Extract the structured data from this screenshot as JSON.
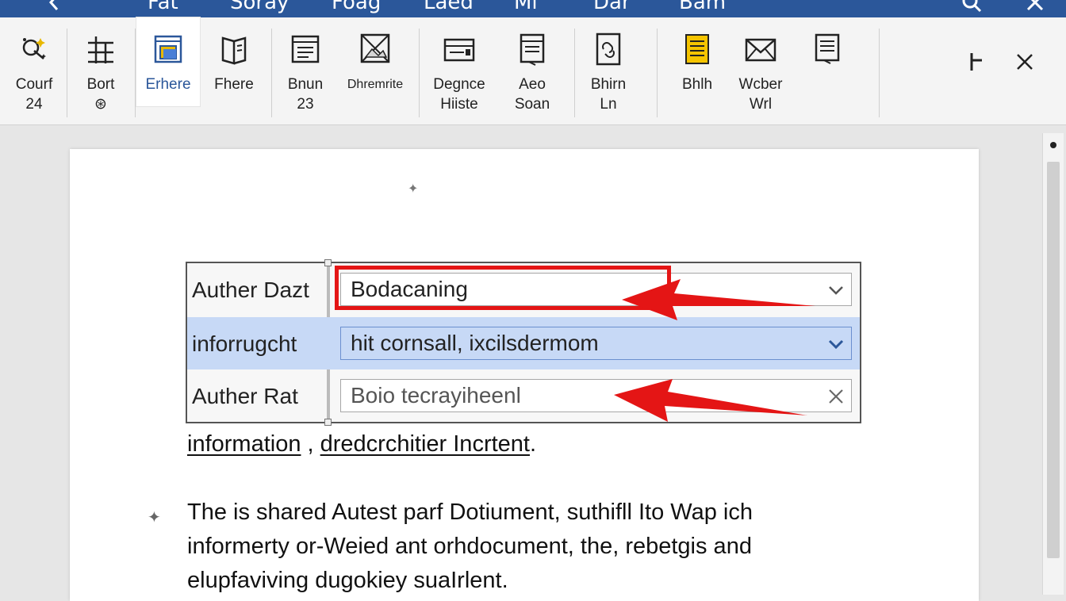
{
  "titlebar": {
    "tabs": [
      "Fat",
      "Soray",
      "Foag",
      "Laed",
      "Ml",
      "Dar",
      "Bam"
    ]
  },
  "ribbon": {
    "buttons": [
      {
        "label": "Courf\n24",
        "icon": "sparkle-icon"
      },
      {
        "label": "Bort\n⊛",
        "icon": "table-tool-icon"
      },
      {
        "label": "Erhere",
        "icon": "insert-frame-icon",
        "active": true
      },
      {
        "label": "Fhere",
        "icon": "book-icon"
      },
      {
        "label": "Bnun\n23",
        "icon": "list-box-icon"
      },
      {
        "label": "Dhremrite",
        "icon": "picture-icon"
      },
      {
        "label": "Degnce\nHiiste",
        "icon": "card-icon"
      },
      {
        "label": "Aeo\nSoan",
        "icon": "document-icon"
      },
      {
        "label": "Bhirn\nLn",
        "icon": "link-document-icon"
      },
      {
        "label": "Bhlh",
        "icon": "yellow-note-icon"
      },
      {
        "label": "Wcber\nWrl",
        "icon": "envelope-icon"
      },
      {
        "label": "",
        "icon": "page-lines-icon"
      }
    ]
  },
  "form": {
    "rows": [
      {
        "label": "Auther Dazt",
        "value": "Bodacaning",
        "control": "dropdown"
      },
      {
        "label": "inforrugcht",
        "value": "hit cornsall, ixcilsdermom",
        "control": "dropdown"
      },
      {
        "label": "Auther Rat",
        "value": "Boio tecrayiheenl",
        "control": "clear"
      }
    ]
  },
  "document": {
    "line1_a": "information",
    "line1_b": " , ",
    "line1_c": "dredcrchitier Incrtent",
    "line1_d": ".",
    "para": [
      "The is shared Autest parf Dotiument, suthifll Ito Wap ich",
      "informerty or-Weied ant orhdocument, the, rebetgis and",
      "elupfaviving dugokiey suaIrlent."
    ]
  },
  "colors": {
    "titlebar": "#2b579a",
    "accent": "#2b579a",
    "annotation": "#e41515",
    "selected_row": "#c7d9f6"
  }
}
